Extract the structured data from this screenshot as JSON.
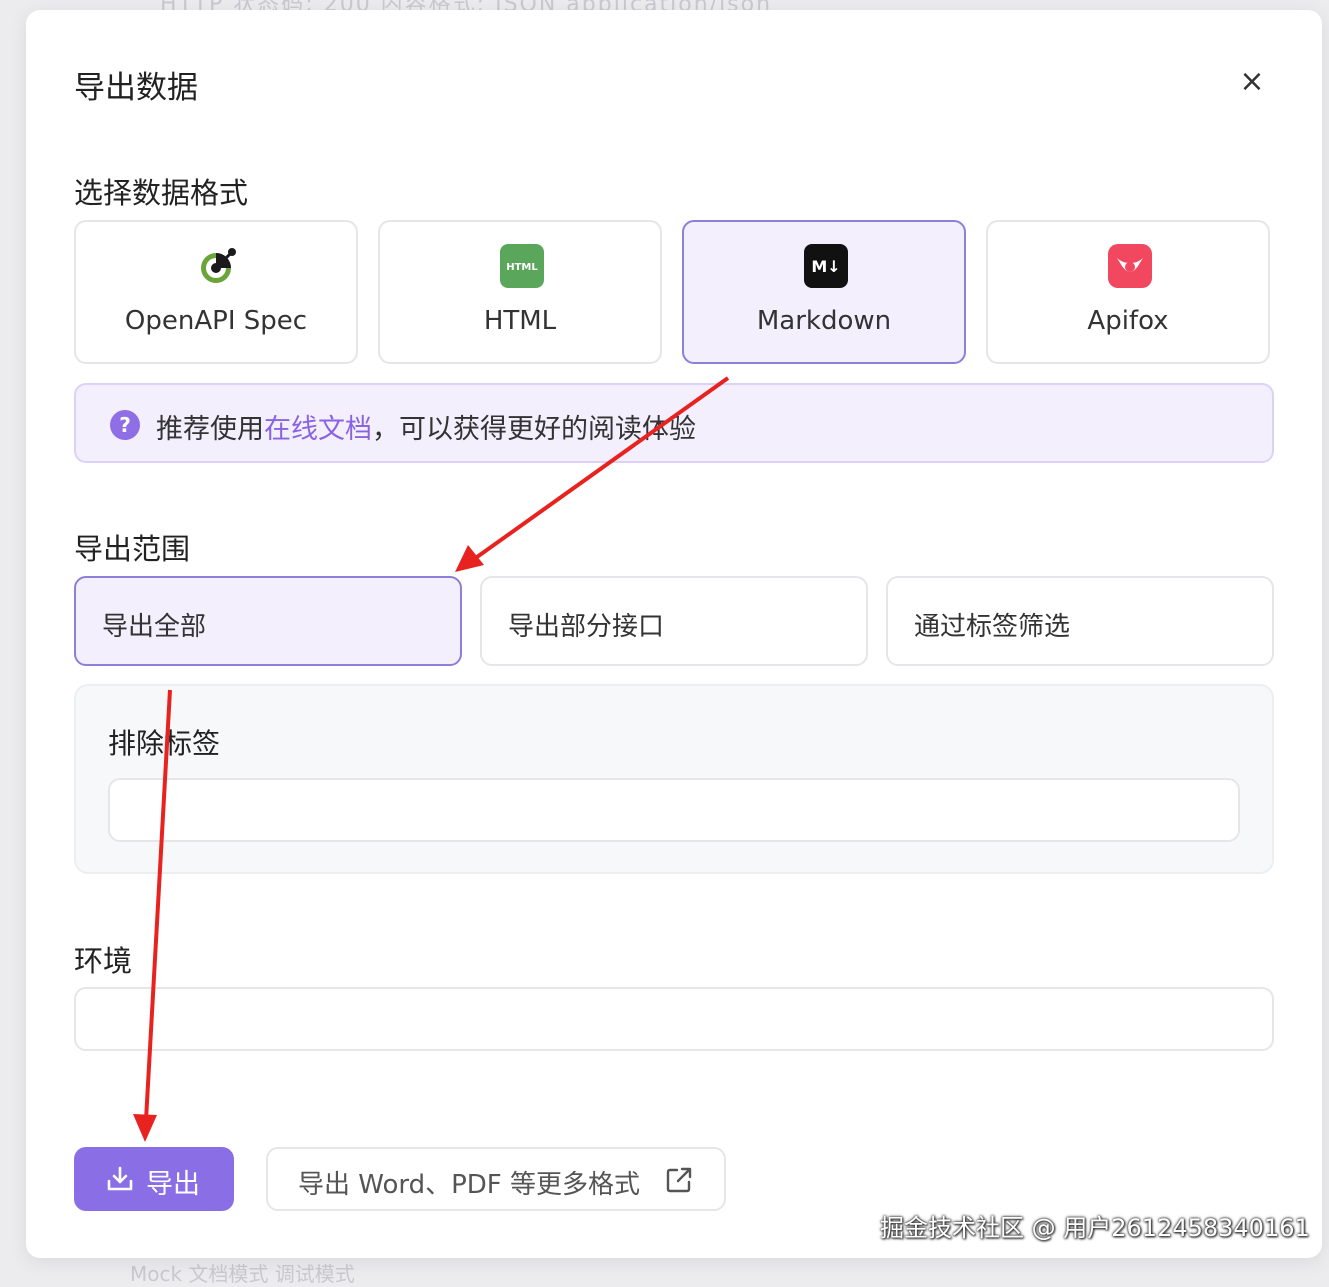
{
  "background": {
    "top_text": "HTTP 状态码: 200    内容格式: JSON    application/json",
    "bottom_text": "Mock  文档模式  调试模式"
  },
  "dialog": {
    "title": "导出数据",
    "close_symbol": "×"
  },
  "format_section": {
    "label": "选择数据格式",
    "options": [
      {
        "label": "OpenAPI Spec",
        "icon": "openapi-logo-icon",
        "selected": false
      },
      {
        "label": "HTML",
        "icon": "html-file-icon",
        "icon_text": "HTML",
        "icon_color": "#5aa65a",
        "selected": false
      },
      {
        "label": "Markdown",
        "icon": "markdown-icon",
        "icon_text": "M↓",
        "icon_color": "#111111",
        "selected": true
      },
      {
        "label": "Apifox",
        "icon": "apifox-logo-icon",
        "icon_color": "#f1475f",
        "selected": false
      }
    ]
  },
  "tip": {
    "icon": "question-icon",
    "icon_text": "?",
    "text_before": "推荐使用",
    "link_text": "在线文档",
    "text_after": "，可以获得更好的阅读体验"
  },
  "range_section": {
    "label": "导出范围",
    "options": [
      {
        "label": "导出全部",
        "selected": true
      },
      {
        "label": "导出部分接口",
        "selected": false
      },
      {
        "label": "通过标签筛选",
        "selected": false
      }
    ]
  },
  "exclude_tags": {
    "label": "排除标签",
    "value": ""
  },
  "environment": {
    "label": "环境",
    "value": ""
  },
  "actions": {
    "export_label": "导出",
    "more_label": "导出 Word、PDF 等更多格式"
  },
  "watermark": "掘金技术社区 @ 用户2612458340161",
  "colors": {
    "accent": "#8a6ee6",
    "selected_bg": "#f3effd",
    "selected_border": "#8e7fd8",
    "arrow": "#e8231f"
  }
}
